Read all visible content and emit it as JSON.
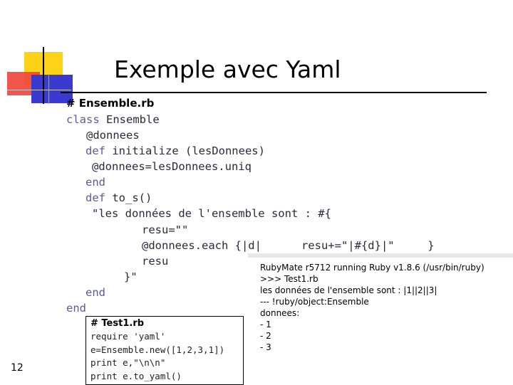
{
  "slide": {
    "title": "Exemple avec Yaml",
    "page_number": "12",
    "file1": {
      "header": "# Ensemble.rb",
      "lines": {
        "l1_kw": "class",
        "l1_rest": " Ensemble",
        "l2": "@donnees",
        "l3_kw": "def",
        "l3_rest": " initialize (lesDonnees)",
        "l4": "@donnees=lesDonnees.uniq",
        "l5_kw": "end",
        "l6_kw": "def",
        "l6_rest": " to_s()",
        "l7": "\"les données de l'ensemble sont : #{",
        "l8": "resu=\"\"",
        "l9": "@donnees.each {|d|      resu+=\"|#{d}|\"     }",
        "l10": "resu",
        "l11": "}\"",
        "l12_kw": "end",
        "l13_kw": "end"
      }
    },
    "file2": {
      "header": "# Test1.rb",
      "lines": [
        "require 'yaml'",
        "e=Ensemble.new([1,2,3,1])",
        "print e,\"\\n\\n\"",
        "print e.to_yaml()"
      ]
    },
    "console": {
      "lines": [
        "RubyMate r5712 running Ruby v1.8.6 (/usr/bin/ruby)",
        ">>> Test1.rb",
        "",
        "les données de l'ensemble sont : |1||2||3|",
        "",
        "--- !ruby/object:Ensemble",
        "donnees:",
        "- 1",
        "- 2",
        "- 3"
      ]
    },
    "colors": {
      "logo_yellow": "#ffd21a",
      "logo_red": "#f0463c",
      "logo_blue": "#3a3ad0",
      "keyword": "#5a5aa0"
    }
  }
}
